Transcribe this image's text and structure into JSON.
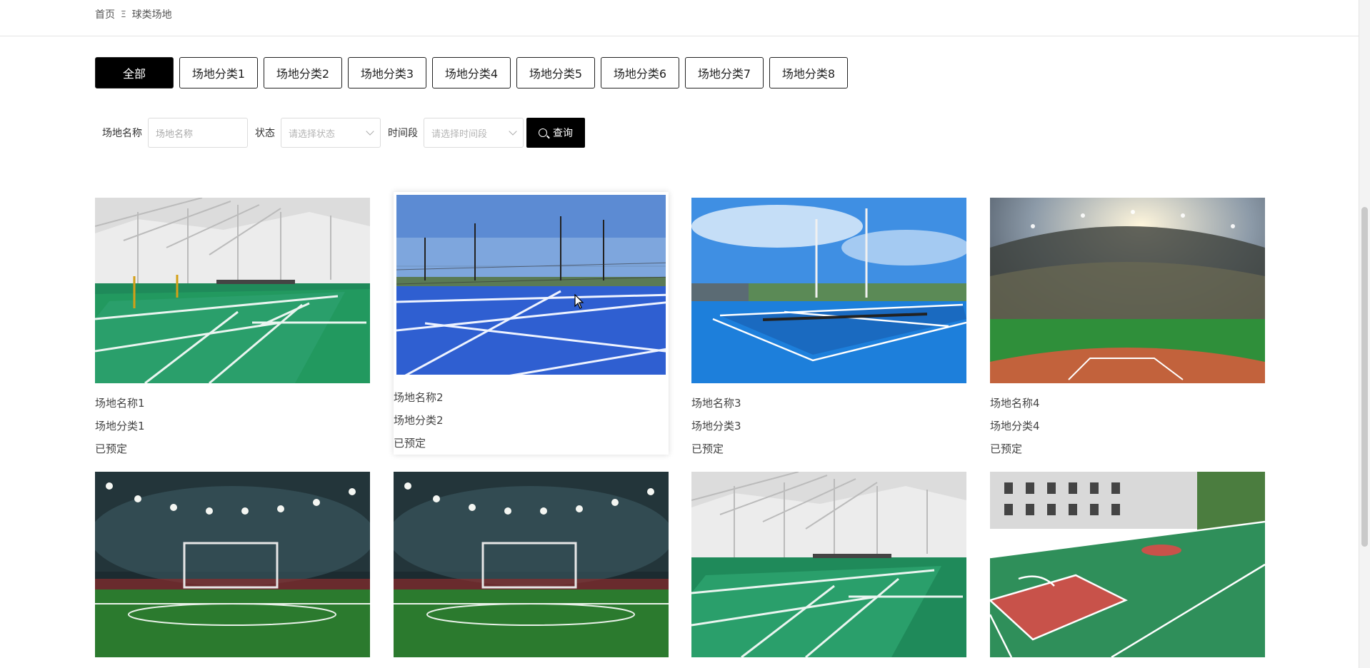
{
  "breadcrumb": {
    "home": "首页",
    "separator": "Ξ",
    "current": "球类场地"
  },
  "categories": [
    "全部",
    "场地分类1",
    "场地分类2",
    "场地分类3",
    "场地分类4",
    "场地分类5",
    "场地分类6",
    "场地分类7",
    "场地分类8"
  ],
  "filters": {
    "name_label": "场地名称",
    "name_placeholder": "场地名称",
    "status_label": "状态",
    "status_placeholder": "请选择状态",
    "time_label": "时间段",
    "time_placeholder": "请选择时间段",
    "query_label": "查询"
  },
  "venues": [
    {
      "name": "场地名称1",
      "category": "场地分类1",
      "status": "已预定",
      "image": "indoor-badminton-court"
    },
    {
      "name": "场地名称2",
      "category": "场地分类2",
      "status": "已预定",
      "image": "outdoor-tennis-court"
    },
    {
      "name": "场地名称3",
      "category": "场地分类3",
      "status": "已预定",
      "image": "blue-tennis-court"
    },
    {
      "name": "场地名称4",
      "category": "场地分类4",
      "status": "已预定",
      "image": "baseball-stadium"
    },
    {
      "image": "football-stadium"
    },
    {
      "image": "football-stadium"
    },
    {
      "image": "indoor-badminton-court"
    },
    {
      "image": "outdoor-basketball-court"
    }
  ]
}
